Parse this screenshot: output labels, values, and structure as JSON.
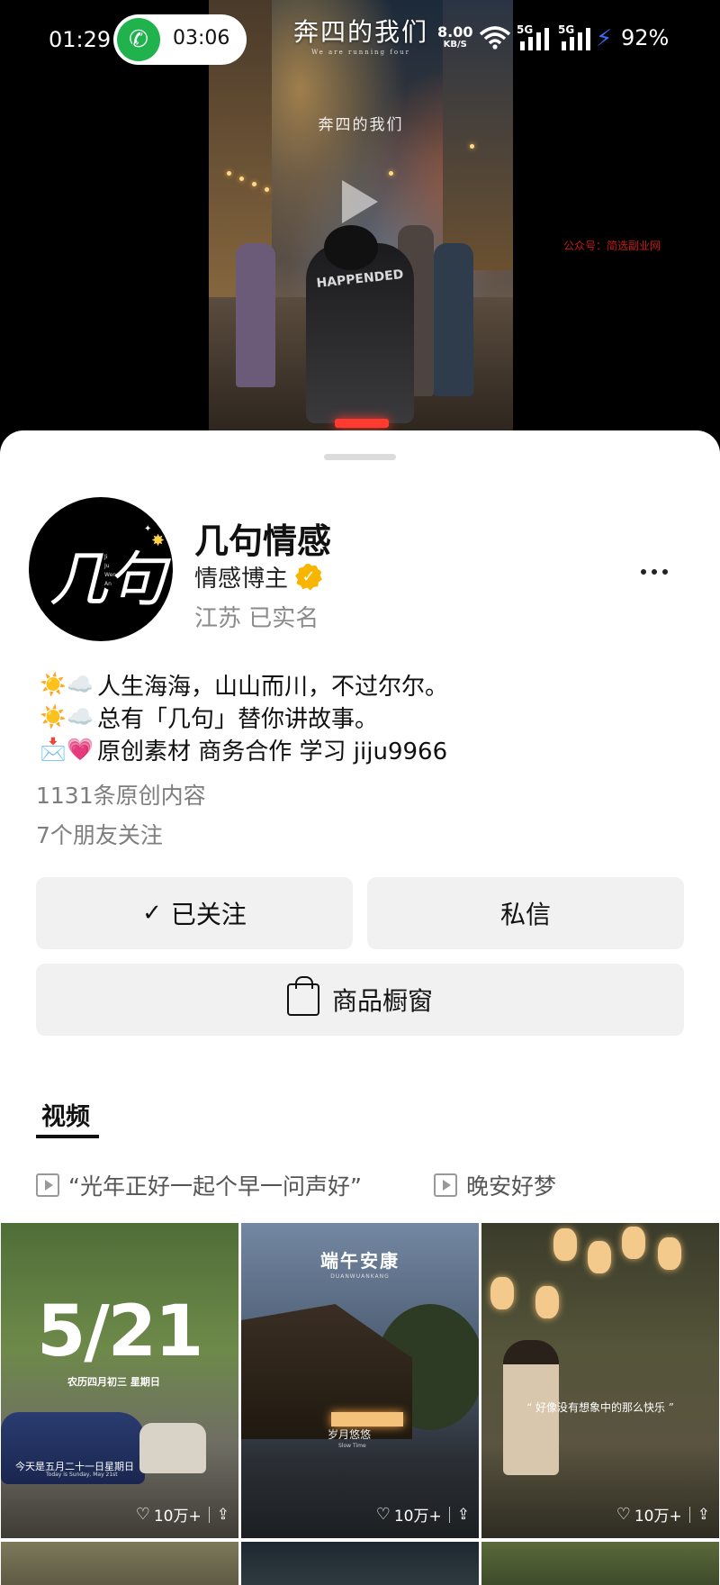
{
  "status_bar": {
    "time": "01:29",
    "call_time": "03:06",
    "net_speed": "8.00",
    "net_unit": "KB/S",
    "sig1": "5G",
    "sig2": "5G",
    "battery": "92%"
  },
  "video": {
    "title": "奔四的我们",
    "subtitle_en": "We are running four",
    "subtitle": "奔四的我们",
    "jacket_text": "HAPPENDED",
    "watermark": "公众号：简选副业网"
  },
  "profile": {
    "avatar_text": "几句",
    "avatar_vert": "Ji Ju Wen An",
    "name": "几句情感",
    "role": "情感博主",
    "location": "江苏  已实名",
    "bio": [
      {
        "icon": "☀️☁️",
        "text": "人生海海，山山而川，不过尔尔。"
      },
      {
        "icon": "☀️☁️",
        "text": "总有「几句」替你讲故事。"
      },
      {
        "icon": "📩💗",
        "text": "原创素材 商务合作 学习 jiju9966"
      }
    ],
    "original_count": "1131条原创内容",
    "friends_follow": "7个朋友关注"
  },
  "actions": {
    "follow_label": "已关注",
    "message_label": "私信",
    "shop_label": "商品橱窗"
  },
  "tabs": {
    "video_label": "视频"
  },
  "playlists": [
    "“光年正好一起个早一问声好”",
    "晚安好梦"
  ],
  "tiles": [
    {
      "big": "5/21",
      "sub": "农历四月初三  星期日",
      "foot": "今天是五月二十一日星期日",
      "foot2": "Today is Sunday, May 21st",
      "likes": "10万+"
    },
    {
      "title": "端午安康",
      "sub": "DUANWUANKANG",
      "cap": "岁月悠悠",
      "cap2": "Slow Time",
      "likes": "10万+"
    },
    {
      "quote": "“ 好像没有想象中的那么快乐 ”",
      "likes": "10万+"
    }
  ]
}
